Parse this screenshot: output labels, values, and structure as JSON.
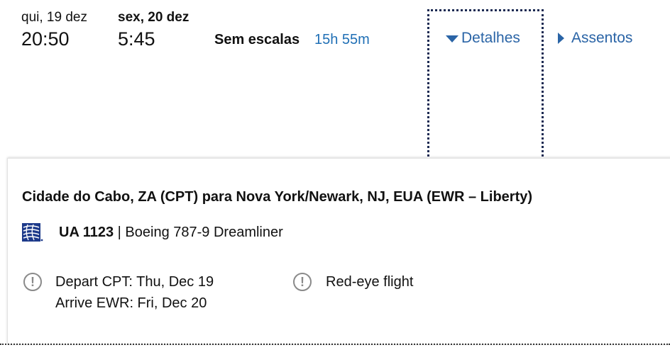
{
  "itinerary": {
    "depart_day": "qui, 19 dez",
    "depart_time": "20:50",
    "arrive_day": "sex, 20 dez",
    "arrive_time": "5:45",
    "stops": "Sem escalas",
    "duration": "15h 55m",
    "details_label": "Detalhes",
    "seats_label": "Assentos"
  },
  "details": {
    "route": "Cidade do Cabo, ZA (CPT) para Nova York/Newark, NJ, EUA (EWR – Liberty)",
    "flight_number": "UA 1123",
    "separator": "|",
    "aircraft": "Boeing 787-9 Dreamliner",
    "notice_depart": "Depart CPT: Thu, Dec 19",
    "notice_arrive": "Arrive EWR: Fri, Dec 20",
    "notice_redeye": "Red-eye flight",
    "alert_glyph": "!"
  },
  "colors": {
    "link": "#2a64a6",
    "duration": "#1f6fb5",
    "focus_ring": "#1b2a52",
    "icon_gray": "#8a8a8a"
  },
  "icons": {
    "details_toggle": "caret-down-icon",
    "seats_toggle": "caret-right-icon",
    "airline_logo": "united-globe-icon",
    "notice": "exclamation-circle-icon"
  }
}
